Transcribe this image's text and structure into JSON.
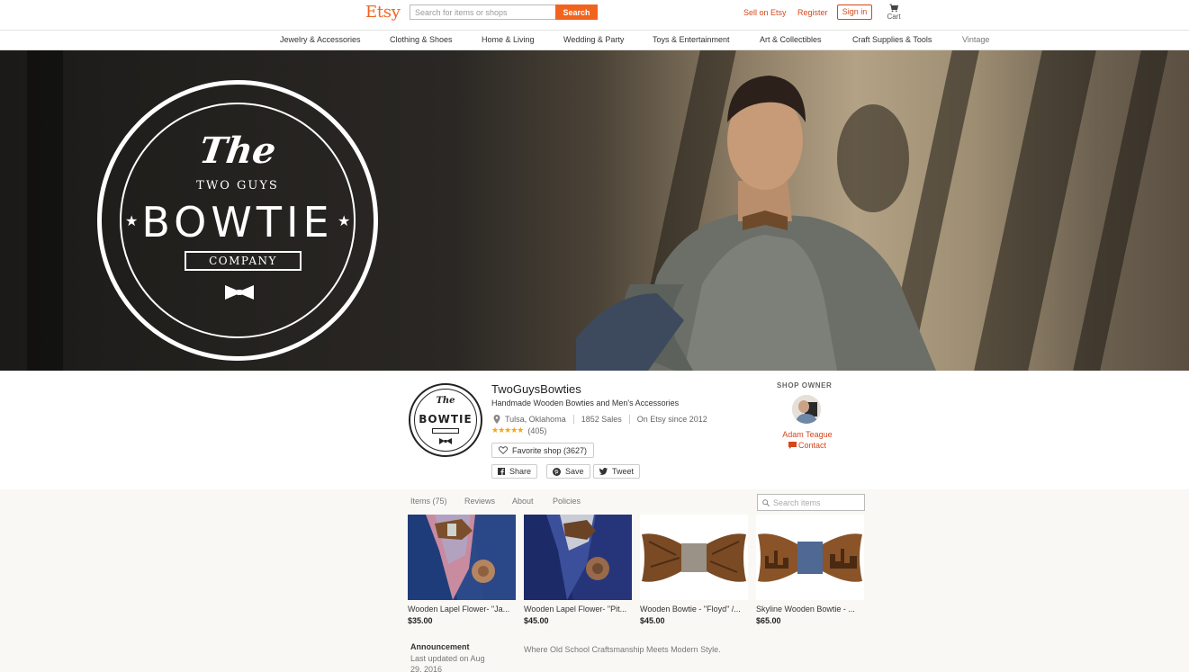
{
  "header": {
    "logo": "Etsy",
    "search_placeholder": "Search for items or shops",
    "search_button": "Search",
    "sell_link": "Sell on Etsy",
    "register_link": "Register",
    "signin_button": "Sign in",
    "cart_label": "Cart"
  },
  "categories": [
    "Jewelry & Accessories",
    "Clothing & Shoes",
    "Home & Living",
    "Wedding & Party",
    "Toys & Entertainment",
    "Art & Collectibles",
    "Craft Supplies & Tools",
    "Vintage"
  ],
  "banner": {
    "logo_the": "The",
    "logo_two_guys": "TWO GUYS",
    "logo_bowtie": "BOWTIE",
    "logo_company": "COMPANY"
  },
  "shop": {
    "name": "TwoGuysBowties",
    "tagline": "Handmade Wooden Bowties and Men's Accessories",
    "location": "Tulsa, Oklahoma",
    "sales": "1852 Sales",
    "since": "On Etsy since 2012",
    "stars": "★★★★★",
    "rating_count": "(405)",
    "favorite_button": "Favorite shop (3627)",
    "share_button": "Share",
    "save_button": "Save",
    "tweet_button": "Tweet",
    "avatar_the": "The",
    "avatar_bowtie": "BOWTIE"
  },
  "owner": {
    "title": "SHOP OWNER",
    "name": "Adam Teague",
    "contact": "Contact"
  },
  "tabs": [
    "Items (75)",
    "Reviews",
    "About",
    "Policies"
  ],
  "items_search_placeholder": "Search items",
  "items": [
    {
      "title": "Wooden Lapel Flower- \"Ja...",
      "price": "$35.00"
    },
    {
      "title": "Wooden Lapel Flower- \"Pit...",
      "price": "$45.00"
    },
    {
      "title": "Wooden Bowtie - \"Floyd\" /...",
      "price": "$45.00"
    },
    {
      "title": "Skyline Wooden Bowtie - ...",
      "price": "$65.00"
    }
  ],
  "announcement": {
    "title": "Announcement",
    "updated": "Last updated on Aug 29, 2016",
    "text": "Where Old School Craftsmanship Meets Modern Style."
  },
  "colors": {
    "brand": "#f1641e",
    "link": "#d5471b",
    "stars": "#f3a716"
  }
}
